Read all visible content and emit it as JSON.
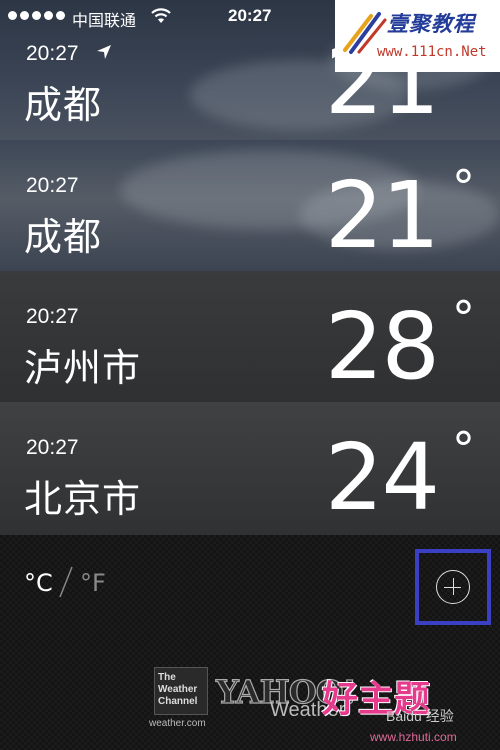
{
  "status_bar": {
    "carrier": "中国联通",
    "time": "20:27"
  },
  "watermark_top": {
    "title": "壹聚教程",
    "url": "www.111cn.Net"
  },
  "cities": [
    {
      "time": "20:27",
      "name": "成都",
      "temperature": "21",
      "degree": "°",
      "current_location": true
    },
    {
      "time": "20:27",
      "name": "成都",
      "temperature": "21",
      "degree": "°",
      "current_location": false
    },
    {
      "time": "20:27",
      "name": "泸州市",
      "temperature": "28",
      "degree": "°",
      "current_location": false
    },
    {
      "time": "20:27",
      "name": "北京市",
      "temperature": "24",
      "degree": "°",
      "current_location": false
    }
  ],
  "footer": {
    "unit_celsius": "°C",
    "unit_fahrenheit": "°F",
    "selected_unit": "C",
    "highlight_color": "#3a3fc4",
    "twc_lines": [
      "The",
      "Weather",
      "Channel"
    ],
    "twc_url": "weather.com",
    "yahoo": "YAHOO!",
    "yahoo_sub": "Weather"
  },
  "watermark_bottom": {
    "big": "好主题",
    "baidu": "Baidu 经验",
    "url": "www.hzhuti.com"
  }
}
